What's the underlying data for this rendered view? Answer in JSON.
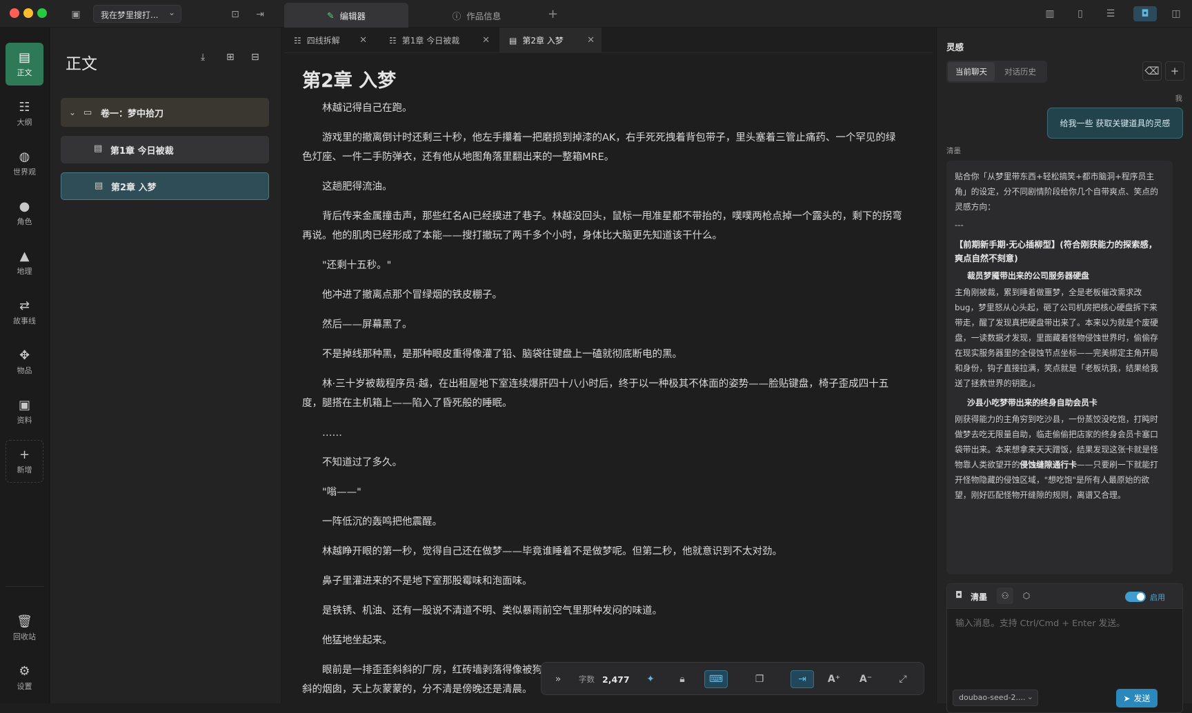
{
  "topbar": {
    "project": "我在梦里搜打...",
    "tab_editor": "编辑器",
    "tab_info": "作品信息"
  },
  "rail": {
    "items": [
      {
        "label": "正文",
        "icon": "document-icon"
      },
      {
        "label": "大纲",
        "icon": "list-icon"
      },
      {
        "label": "世界观",
        "icon": "globe-icon"
      },
      {
        "label": "角色",
        "icon": "users-icon"
      },
      {
        "label": "地理",
        "icon": "mountain-icon"
      },
      {
        "label": "故事线",
        "icon": "storyline-icon"
      },
      {
        "label": "物品",
        "icon": "puzzle-icon"
      },
      {
        "label": "资料",
        "icon": "database-icon"
      },
      {
        "label": "新增",
        "icon": "plus-icon"
      }
    ],
    "trash": "回收站",
    "settings": "设置"
  },
  "sidebar": {
    "title": "正文",
    "volume": "卷一：梦中拾刀",
    "chapters": [
      "第1章 今日被裁",
      "第2章 入梦"
    ]
  },
  "file_tabs": [
    "四线拆解",
    "第1章 今日被裁",
    "第2章 入梦"
  ],
  "document": {
    "title": "第2章 入梦",
    "paragraphs": [
      "林越记得自己在跑。",
      "游戏里的撤离倒计时还剩三十秒，他左手攥着一把磨损到掉漆的AK，右手死死拽着背包带子，里头塞着三管止痛药、一个罕见的绿色灯座、一件二手防弹衣，还有他从地图角落里翻出来的一整箱MRE。",
      "这趟肥得流油。",
      "背后传来金属撞击声，那些红名AI已经摸进了巷子。林越没回头，鼠标一甩准星都不带抬的，噗噗两枪点掉一个露头的，剩下的拐弯再说。他的肌肉已经形成了本能——搜打撤玩了两千多个小时，身体比大脑更先知道该干什么。",
      "\"还剩十五秒。\"",
      "他冲进了撤离点那个冒绿烟的铁皮棚子。",
      "然后——屏幕黑了。",
      "不是掉线那种黑，是那种眼皮重得像灌了铅、脑袋往键盘上一磕就彻底断电的黑。",
      "林·三十岁被裁程序员·越，在出租屋地下室连续爆肝四十八小时后，终于以一种极其不体面的姿势——脸贴键盘，椅子歪成四十五度，腿搭在主机箱上——陷入了昏死般的睡眠。",
      "……",
      "不知道过了多久。",
      "\"嗡——\"",
      "一阵低沉的轰鸣把他震醒。",
      "林越睁开眼的第一秒，觉得自己还在做梦——毕竟谁睡着不是做梦呢。但第二秒，他就意识到不太对劲。",
      "鼻子里灌进来的不是地下室那股霉味和泡面味。",
      "是铁锈、机油、还有一股说不清道不明、类似暴雨前空气里那种发闷的味道。",
      "他猛地坐起来。",
      "眼前是一排歪歪斜斜的厂房，红砖墙剥落得像被狗啃过一样，墙根底下堆着锈成一团的钢筋和不知道谁丢的破轮胎。远处立着一根歪斜的烟囱，天上灰蒙蒙的，分不清是傍晚还是清晨。"
    ]
  },
  "bottom_toolbar": {
    "word_label": "字数",
    "word_count": "2,477"
  },
  "right_panel": {
    "title": "灵感",
    "seg_current": "当前聊天",
    "seg_history": "对话历史",
    "me_label": "我",
    "user_message": "给我一些 获取关键道具的灵感",
    "bot_name": "清墨",
    "bot_intro": "贴合你「从梦里带东西+轻松搞笑+都市脑洞+程序员主角」的设定，分不同剧情阶段给你几个自带爽点、笑点的灵感方向：",
    "bot_sep": "---",
    "bot_section": "【前期新手期·无心插柳型】(符合刚获能力的探索感，爽点自然不刻意)",
    "idea1_title": "裁员梦魇带出来的公司服务器硬盘",
    "idea1_body": "主角刚被裁，累到睡着做噩梦，全是老板催改需求改bug，梦里怒从心头起，砸了公司机房把核心硬盘拆下来带走，醒了发现真把硬盘带出来了。本来以为就是个废硬盘，一读数据才发现，里面藏着怪物侵蚀世界时，偷偷存在现实服务器里的全侵蚀节点坐标——完美绑定主角开局和身份，钩子直接拉满，笑点就是「老板坑我，结果给我送了拯救世界的钥匙」。",
    "idea2_title": "沙县小吃梦带出来的终身自助会员卡",
    "idea2_body_a": "刚获得能力的主角穷到吃沙县，一份蒸饺没吃饱，打盹时做梦去吃无限量自助，临走偷偷把店家的终身会员卡塞口袋带出来。本来想拿来天天蹭饭，结果发现这张卡就是怪物靠人类欲望开的",
    "idea2_bold": "侵蚀缝隙通行卡",
    "idea2_body_b": "——只要刷一下就能打开怪物隐藏的侵蚀区域，\"想吃饱\"是所有人最原始的欲望，刚好匹配怪物开缝隙的规则，离谱又合理。",
    "composer_agent": "清墨",
    "composer_toggle": "启用",
    "composer_placeholder": "输入消息。支持 Ctrl/Cmd + Enter 发送。",
    "model": "doubao-seed-2....",
    "send": "发送"
  },
  "colors": {
    "accent_green": "#2e7a56",
    "accent_blue": "#2a88bd"
  }
}
